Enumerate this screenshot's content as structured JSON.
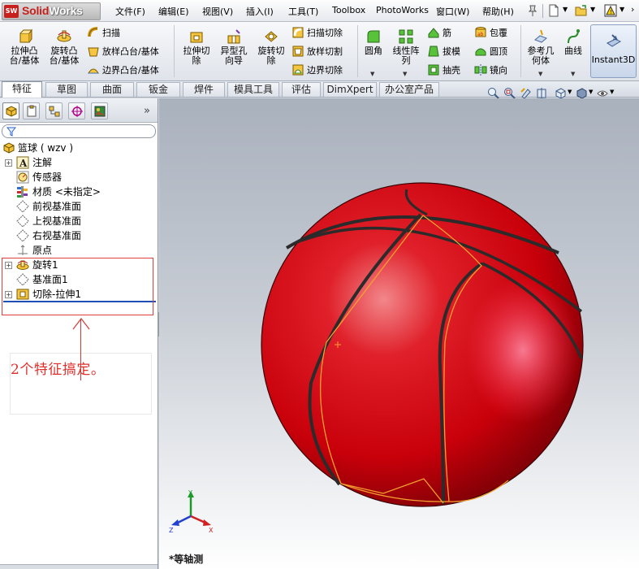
{
  "app": {
    "logo_prefix": "SW",
    "logo_text_a": "Solid",
    "logo_text_b": "Works"
  },
  "menu": {
    "items": [
      {
        "label": "文件(F)"
      },
      {
        "label": "编辑(E)"
      },
      {
        "label": "视图(V)"
      },
      {
        "label": "插入(I)"
      },
      {
        "label": "工具(T)"
      },
      {
        "label": "Toolbox"
      },
      {
        "label": "PhotoWorks"
      },
      {
        "label": "窗口(W)"
      },
      {
        "label": "帮助(H)"
      }
    ]
  },
  "ribbon": {
    "extrude_boss": "拉伸凸\n台/基体",
    "revolve_boss": "旋转凸\n台/基体",
    "sweep": "扫描",
    "loft_boss": "放样凸台/基体",
    "boundary_boss": "边界凸台/基体",
    "extrude_cut": "拉伸切\n除",
    "hole_wizard": "异型孔\n向导",
    "revolve_cut": "旋转切\n除",
    "sweep_cut": "扫描切除",
    "loft_cut": "放样切割",
    "boundary_cut": "边界切除",
    "fillet": "圆角",
    "linear_pattern": "线性阵\n列",
    "rib": "筋",
    "draft": "拔模",
    "shell": "抽壳",
    "wrap": "包覆",
    "dome": "圆顶",
    "mirror": "镜向",
    "ref_geometry": "参考几\n何体",
    "curves": "曲线",
    "instant3d": "Instant3D"
  },
  "command_tabs": [
    {
      "label": "特征",
      "active": true
    },
    {
      "label": "草图"
    },
    {
      "label": "曲面"
    },
    {
      "label": "钣金"
    },
    {
      "label": "焊件"
    },
    {
      "label": "模具工具"
    },
    {
      "label": "评估"
    },
    {
      "label": "DimXpert"
    },
    {
      "label": "办公室产品"
    }
  ],
  "tree": {
    "root": "篮球 ( wzv )",
    "items": [
      {
        "label": "注解",
        "icon": "annotation-icon",
        "expandable": true
      },
      {
        "label": "传感器",
        "icon": "sensor-icon"
      },
      {
        "label": "材质 <未指定>",
        "icon": "material-icon"
      },
      {
        "label": "前视基准面",
        "icon": "plane-icon"
      },
      {
        "label": "上视基准面",
        "icon": "plane-icon"
      },
      {
        "label": "右视基准面",
        "icon": "plane-icon"
      },
      {
        "label": "原点",
        "icon": "origin-icon"
      },
      {
        "label": "旋转1",
        "icon": "revolve-feature-icon",
        "expandable": true
      },
      {
        "label": "基准面1",
        "icon": "plane-icon"
      },
      {
        "label": "切除-拉伸1",
        "icon": "cut-extrude-feature-icon",
        "expandable": true
      }
    ]
  },
  "annotation": {
    "text": "2个特征搞定。"
  },
  "viewport": {
    "view_label": "*等轴测",
    "triad": {
      "x": "X",
      "y": "Y",
      "z": "Z"
    }
  },
  "colors": {
    "ball_red": "#c8000a",
    "seam_dark": "#3a3a3a",
    "seam_orange": "#f5a030",
    "annotation_red": "#e0302c"
  }
}
